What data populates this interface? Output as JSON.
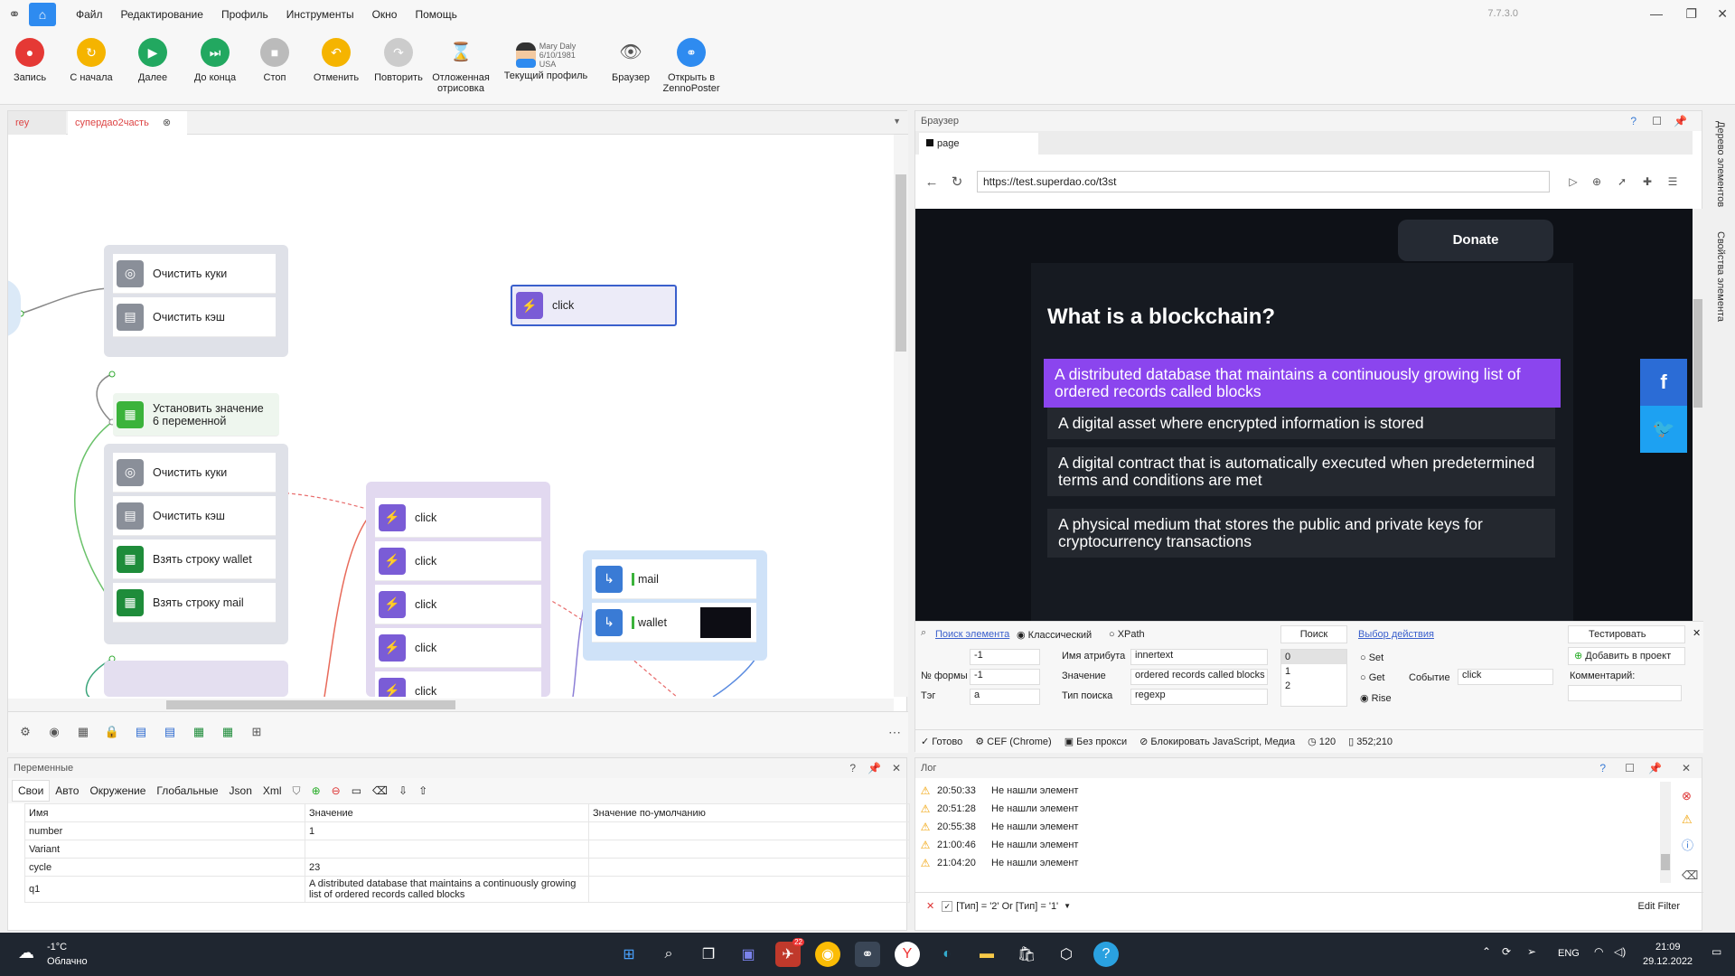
{
  "menu": {
    "items": [
      "Файл",
      "Редактирование",
      "Профиль",
      "Инструменты",
      "Окно",
      "Помощь"
    ],
    "version": "7.7.3.0"
  },
  "toolbar": {
    "record": "Запись",
    "restart": "С начала",
    "next": "Далее",
    "to_end": "До конца",
    "stop": "Стоп",
    "undo": "Отменить",
    "redo": "Повторить",
    "delayed_1": "Отложенная",
    "delayed_2": "отрисовка",
    "profile": "Текущий профиль",
    "profile_name": "Mary Daly",
    "profile_date": "6/10/1981",
    "profile_country": "USA",
    "browser": "Браузер",
    "open_1": "Открыть в",
    "open_2": "ZennoPoster"
  },
  "editor": {
    "tabs": [
      "rey",
      "супердао2часть"
    ],
    "nodes": {
      "clear_cookies_1": "Очистить куки",
      "clear_cache_1": "Очистить кэш",
      "set_value": "Установить значение",
      "set_value_2": "6 переменной",
      "click_standalone": "click",
      "clear_cookies_2": "Очистить куки",
      "clear_cache_2": "Очистить кэш",
      "take_wallet": "Взять строку wallet",
      "take_mail": "Взять строку mail",
      "click": "click",
      "mail": "mail",
      "wallet": "wallet"
    }
  },
  "vars": {
    "title": "Переменные",
    "tabs": [
      "Свои",
      "Авто",
      "Окружение",
      "Глобальные",
      "Json",
      "Xml"
    ],
    "columns": [
      "Имя",
      "Значение",
      "Значение по-умолчанию"
    ],
    "rows": [
      {
        "name": "number",
        "value": "1",
        "default": ""
      },
      {
        "name": "Variant",
        "value": "",
        "default": ""
      },
      {
        "name": "cycle",
        "value": "23",
        "default": ""
      },
      {
        "name": "q1",
        "value": "A distributed database that maintains a continuously growing list of ordered records called blocks",
        "default": ""
      }
    ]
  },
  "browser": {
    "title": "Браузер",
    "tab": "page",
    "url": "https://test.superdao.co/t3st",
    "donate": "Donate",
    "question": "What is a blockchain?",
    "answers": [
      "A distributed database that maintains a continuously growing list of ordered records called blocks",
      "A digital asset where encrypted information is stored",
      "A digital contract that is automatically executed when predetermined terms and conditions are met",
      "A physical medium that stores the public and private keys for cryptocurrency transactions"
    ],
    "fb": "f",
    "tw": "🐦",
    "search": {
      "search_link": "Поиск элемента",
      "classic": "Классический",
      "xpath": "XPath",
      "search_btn": "Поиск",
      "choose_action": "Выбор действия",
      "test": "Тестировать",
      "add_project": "Добавить в проект",
      "comment": "Комментарий:",
      "form_no_label": "№ формы",
      "tag_label": "Тэг",
      "attr_label": "Имя атрибута",
      "value_label": "Значение",
      "type_label": "Тип поиска",
      "idx1": "-1",
      "idx2": "-1",
      "tag": "a",
      "attr": "innertext",
      "value": "ordered records called blocks",
      "type": "regexp",
      "results": [
        "0",
        "1",
        "2"
      ],
      "set": "Set",
      "get": "Get",
      "rise": "Rise",
      "event_label": "Событие",
      "event": "click"
    },
    "status": {
      "ready": "Готово",
      "engine": "CEF (Chrome)",
      "proxy": "Без прокси",
      "block": "Блокировать JavaScript, Медиа",
      "timeout": "120",
      "coords": "352;210"
    }
  },
  "side_tabs": [
    "Дерево элементов",
    "Свойства элемента"
  ],
  "log": {
    "title": "Лог",
    "entries": [
      {
        "time": "20:50:33",
        "msg": "Не нашли элемент"
      },
      {
        "time": "20:51:28",
        "msg": "Не нашли элемент"
      },
      {
        "time": "20:55:38",
        "msg": "Не нашли элемент"
      },
      {
        "time": "21:00:46",
        "msg": "Не нашли элемент"
      },
      {
        "time": "21:04:20",
        "msg": "Не нашли элемент"
      }
    ],
    "filter": "[Тип] = '2' Or [Тип] = '1'",
    "edit_filter": "Edit Filter"
  },
  "taskbar": {
    "temp": "-1°C",
    "weather": "Облачно",
    "lang": "ENG",
    "time": "21:09",
    "date": "29.12.2022",
    "badge": "22"
  }
}
